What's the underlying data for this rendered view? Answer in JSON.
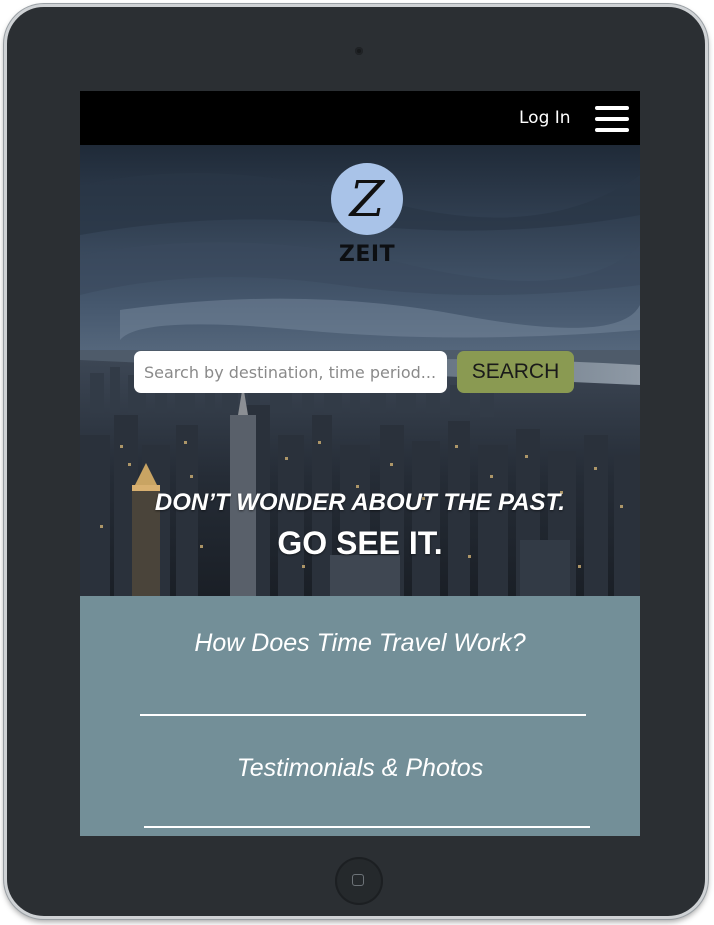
{
  "site": {
    "logo_letter": "Z",
    "logo_name": "ZEIT"
  },
  "header": {
    "login_label": "Log In",
    "menu_icon": "hamburger-menu-icon"
  },
  "search": {
    "placeholder": "Search by destination, time period...",
    "value": "",
    "button_label": "SEARCH",
    "button_color": "#8a9a52"
  },
  "hero": {
    "tagline_line1": "DON’T WONDER ABOUT THE PAST.",
    "tagline_line2": "GO SEE IT."
  },
  "nav": {
    "items": [
      {
        "label": "How Does Time Travel Work?"
      },
      {
        "label": "Testimonials & Photos"
      }
    ]
  },
  "colors": {
    "topbar": "#000000",
    "logo_circle": "#a9c3e8",
    "content_background": "#738f98",
    "device_body": "#2b2f33"
  }
}
